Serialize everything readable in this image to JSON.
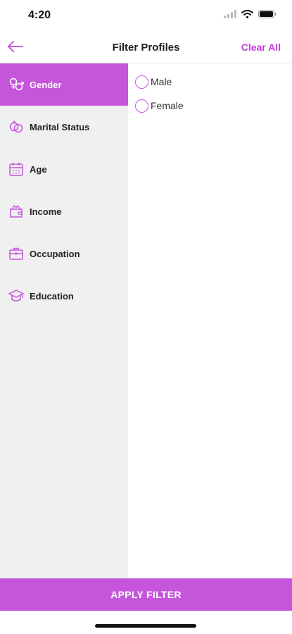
{
  "status_bar": {
    "time": "4:20"
  },
  "header": {
    "title": "Filter Profiles",
    "clear_all": "Clear All"
  },
  "sidebar": {
    "items": [
      {
        "label": "Gender",
        "icon": "gender-icon",
        "active": true
      },
      {
        "label": "Marital Status",
        "icon": "rings-icon",
        "active": false
      },
      {
        "label": "Age",
        "icon": "calendar-icon",
        "active": false
      },
      {
        "label": "Income",
        "icon": "wallet-icon",
        "active": false
      },
      {
        "label": "Occupation",
        "icon": "briefcase-icon",
        "active": false
      },
      {
        "label": "Education",
        "icon": "graduation-cap-icon",
        "active": false
      }
    ]
  },
  "options": [
    {
      "label": "Male",
      "selected": false
    },
    {
      "label": "Female",
      "selected": false
    }
  ],
  "footer": {
    "apply_label": "APPLY FILTER"
  },
  "colors": {
    "accent": "#c556dc",
    "sidebar_bg": "#f0f0f0"
  }
}
